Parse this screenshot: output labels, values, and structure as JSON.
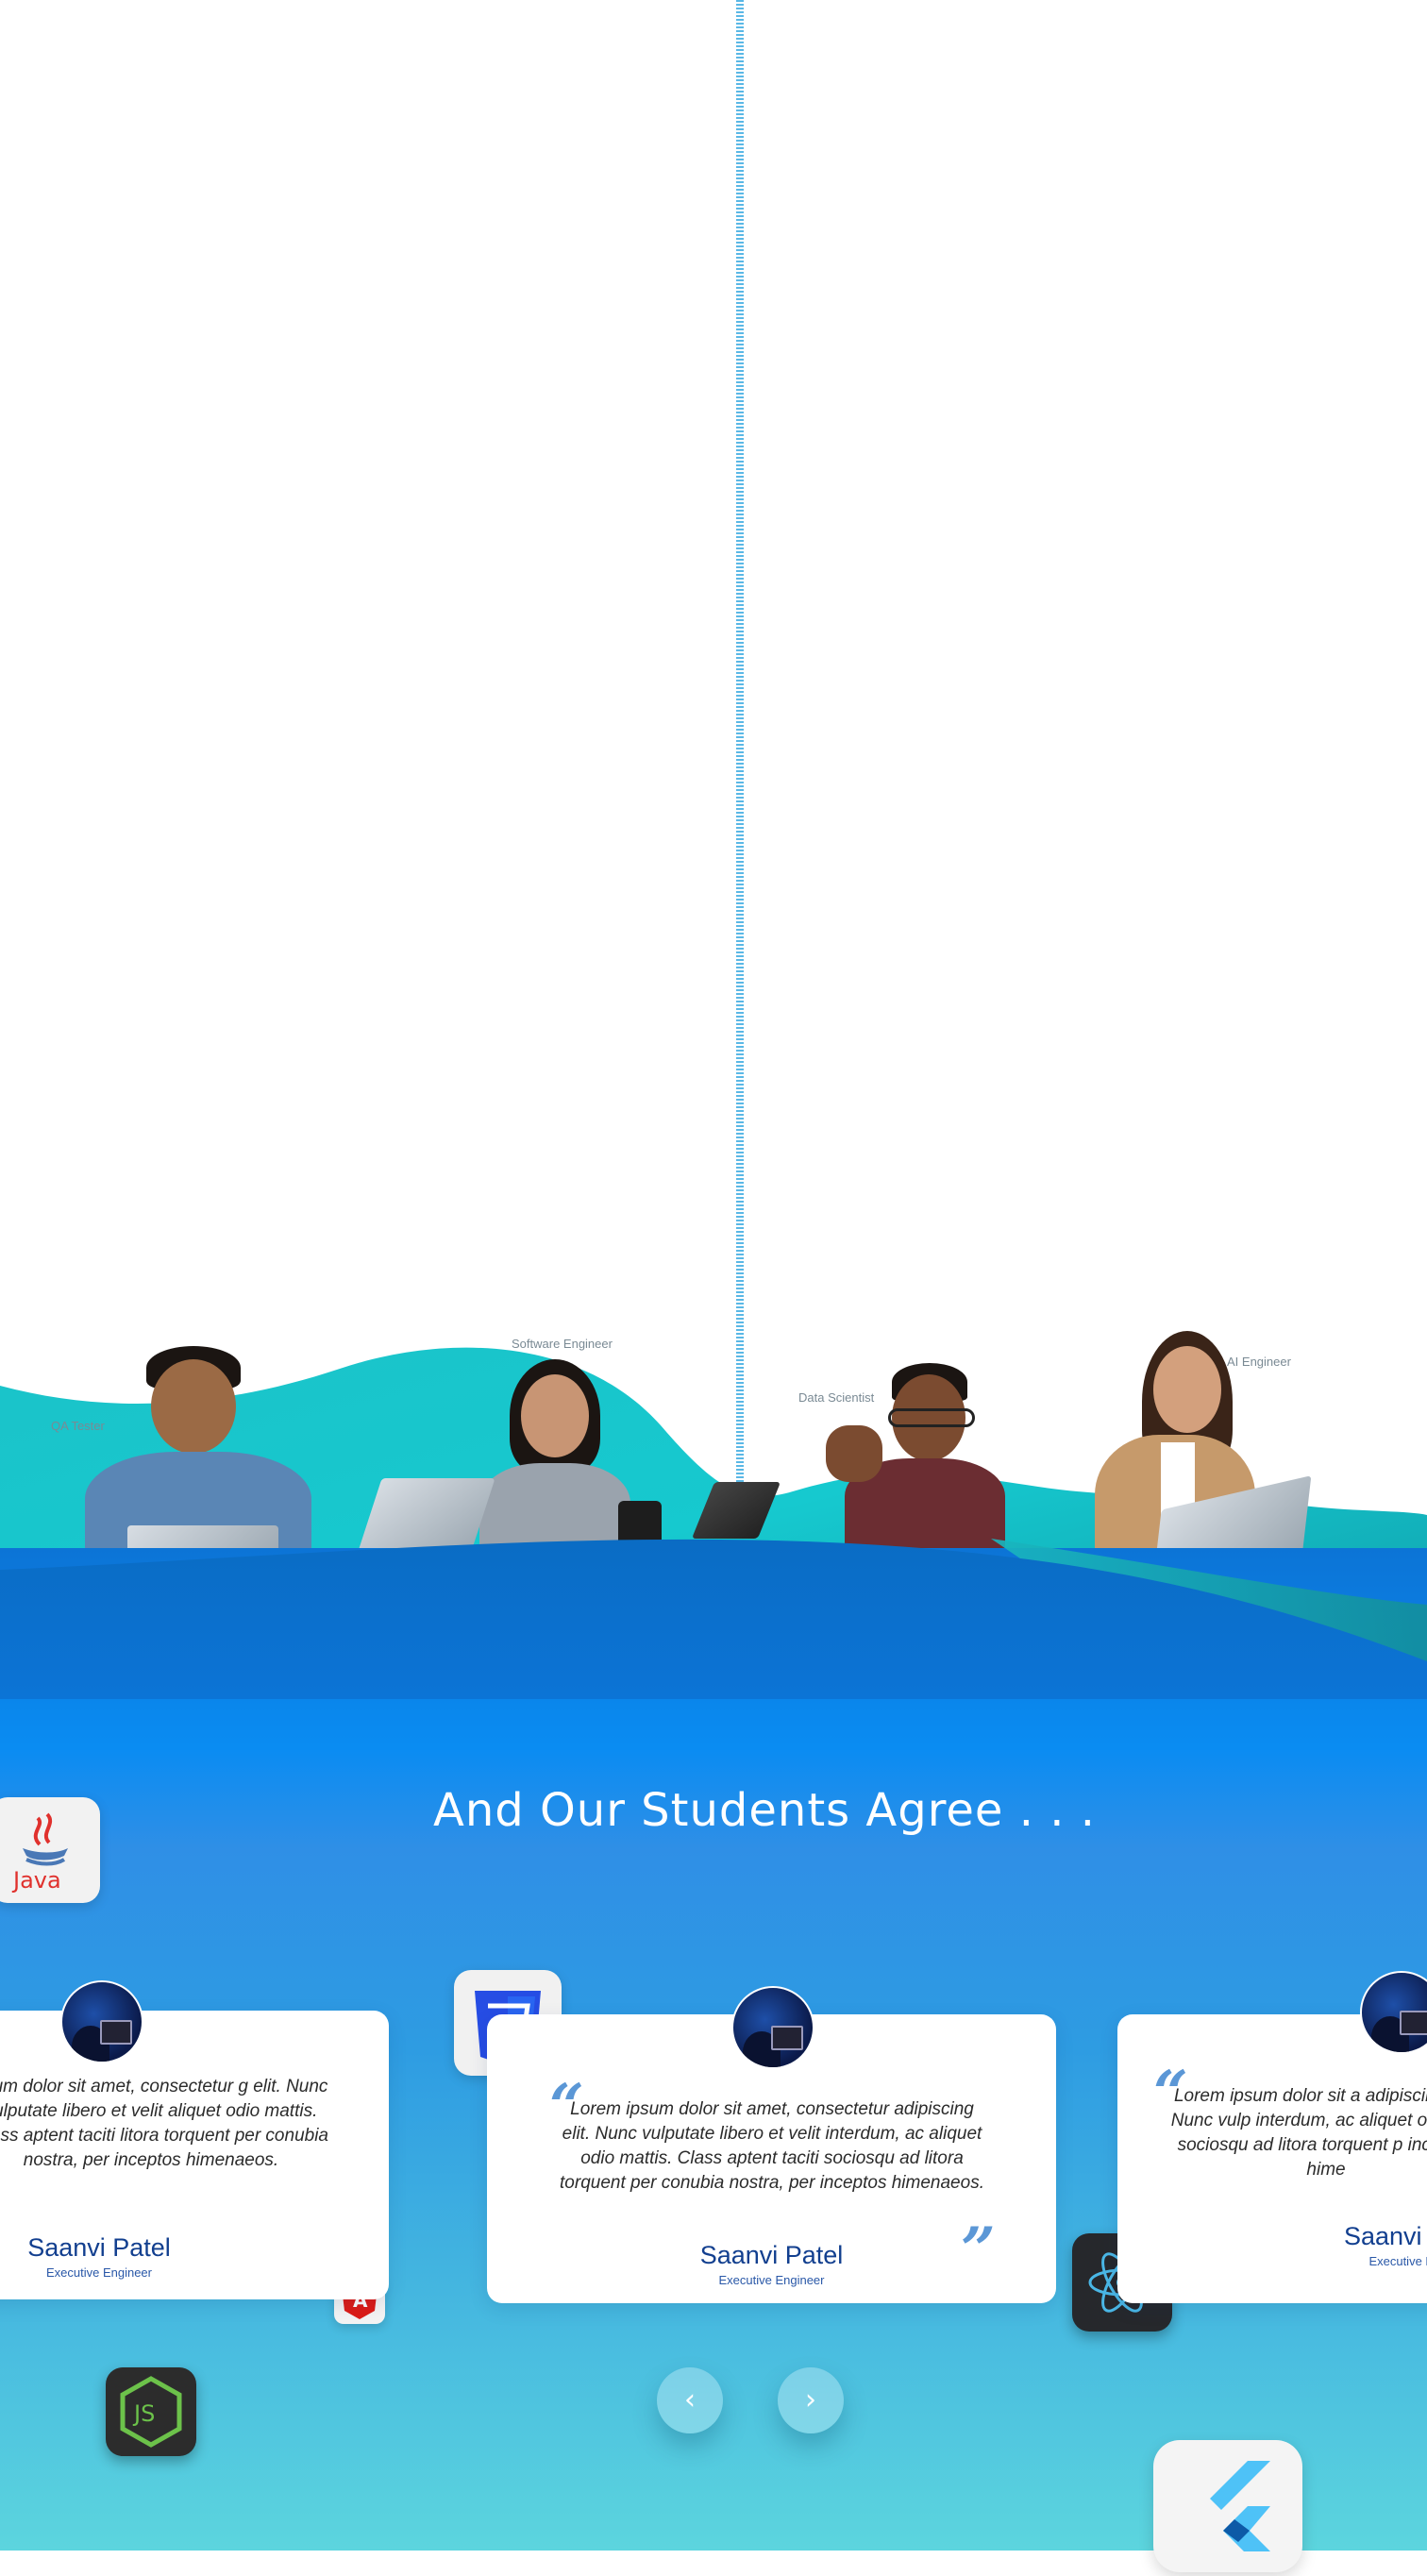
{
  "roles": {
    "qa": "QA Tester",
    "software": "Software Engineer",
    "data": "Data Scientist",
    "ai": "AI Engineer"
  },
  "testimonials": {
    "heading": "And Our Students Agree . . .",
    "cards": [
      {
        "quote": "psum dolor sit amet, consectetur g elit. Nunc vulputate libero et velit aliquet odio mattis. Class aptent taciti litora torquent per conubia nostra, per inceptos himenaeos.",
        "name": "Saanvi Patel",
        "title": "Executive Engineer"
      },
      {
        "quote": "Lorem ipsum dolor sit amet, consectetur adipiscing elit. Nunc vulputate libero et velit interdum, ac aliquet odio mattis. Class aptent taciti sociosqu ad litora torquent per conubia nostra, per inceptos himenaeos.",
        "name": "Saanvi Patel",
        "title": "Executive Engineer"
      },
      {
        "quote": "Lorem ipsum dolor sit a adipiscing elit. Nunc vulp interdum, ac aliquet odio ma sociosqu ad litora torquent p inceptos hime",
        "name": "Saanvi P",
        "title": "Executive Eng"
      }
    ],
    "prev_icon": "chevron-left-icon",
    "next_icon": "chevron-right-icon",
    "prev_label": "‹",
    "next_label": "›"
  },
  "tech_logos": {
    "java": "Java",
    "angular": "A",
    "node": "JS"
  },
  "colors": {
    "teal": "#1fd3d8",
    "blue": "#0a8cf2",
    "name_blue": "#123f8f",
    "quote_mark": "#5b97d6"
  }
}
